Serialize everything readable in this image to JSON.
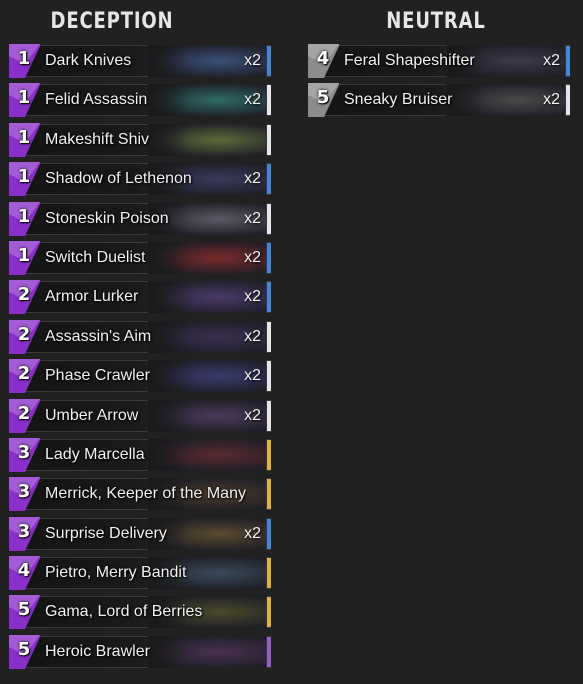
{
  "colors": {
    "common": "#e6e6e6",
    "rare": "#3f88d8",
    "epic": "#9b5bc4",
    "legendary": "#e0b23a",
    "deception_gem": "#8a2fc9",
    "neutral_gem": "#8c8c8c"
  },
  "deception": {
    "title": "DECEPTION",
    "cards": [
      {
        "cost": "1",
        "name": "Dark Knives",
        "count": "x2",
        "rarity": "rare",
        "art": "#3a4f78"
      },
      {
        "cost": "1",
        "name": "Felid Assassin",
        "count": "x2",
        "rarity": "common",
        "art": "#2f6a66"
      },
      {
        "cost": "1",
        "name": "Makeshift Shiv",
        "count": "",
        "rarity": "common",
        "art": "#5b6a3a"
      },
      {
        "cost": "1",
        "name": "Shadow of Lethenon",
        "count": "x2",
        "rarity": "rare",
        "art": "#3a3a5a"
      },
      {
        "cost": "1",
        "name": "Stoneskin Poison",
        "count": "x2",
        "rarity": "common",
        "art": "#5a5a66"
      },
      {
        "cost": "1",
        "name": "Switch Duelist",
        "count": "x2",
        "rarity": "rare",
        "art": "#7a2a2a"
      },
      {
        "cost": "2",
        "name": "Armor Lurker",
        "count": "x2",
        "rarity": "rare",
        "art": "#4a3a6a"
      },
      {
        "cost": "2",
        "name": "Assassin's Aim",
        "count": "x2",
        "rarity": "common",
        "art": "#3a3050"
      },
      {
        "cost": "2",
        "name": "Phase Crawler",
        "count": "x2",
        "rarity": "common",
        "art": "#3a3a70"
      },
      {
        "cost": "2",
        "name": "Umber Arrow",
        "count": "x2",
        "rarity": "common",
        "art": "#4a3a5a"
      },
      {
        "cost": "3",
        "name": "Lady Marcella",
        "count": "",
        "rarity": "legendary",
        "art": "#5a2a30"
      },
      {
        "cost": "3",
        "name": "Merrick, Keeper of the Many",
        "count": "",
        "rarity": "legendary",
        "art": "#4a3a2a"
      },
      {
        "cost": "3",
        "name": "Surprise Delivery",
        "count": "x2",
        "rarity": "rare",
        "art": "#5a4a30"
      },
      {
        "cost": "4",
        "name": "Pietro, Merry Bandit",
        "count": "",
        "rarity": "legendary",
        "art": "#3a4a5a"
      },
      {
        "cost": "5",
        "name": "Gama, Lord of Berries",
        "count": "",
        "rarity": "legendary",
        "art": "#4a4a2a"
      },
      {
        "cost": "5",
        "name": "Heroic Brawler",
        "count": "",
        "rarity": "epic",
        "art": "#4a3050"
      }
    ]
  },
  "neutral": {
    "title": "NEUTRAL",
    "cards": [
      {
        "cost": "4",
        "name": "Feral Shapeshifter",
        "count": "x2",
        "rarity": "rare",
        "art": "#3a3a4a"
      },
      {
        "cost": "5",
        "name": "Sneaky Bruiser",
        "count": "x2",
        "rarity": "common",
        "art": "#4a4a4a"
      }
    ]
  }
}
